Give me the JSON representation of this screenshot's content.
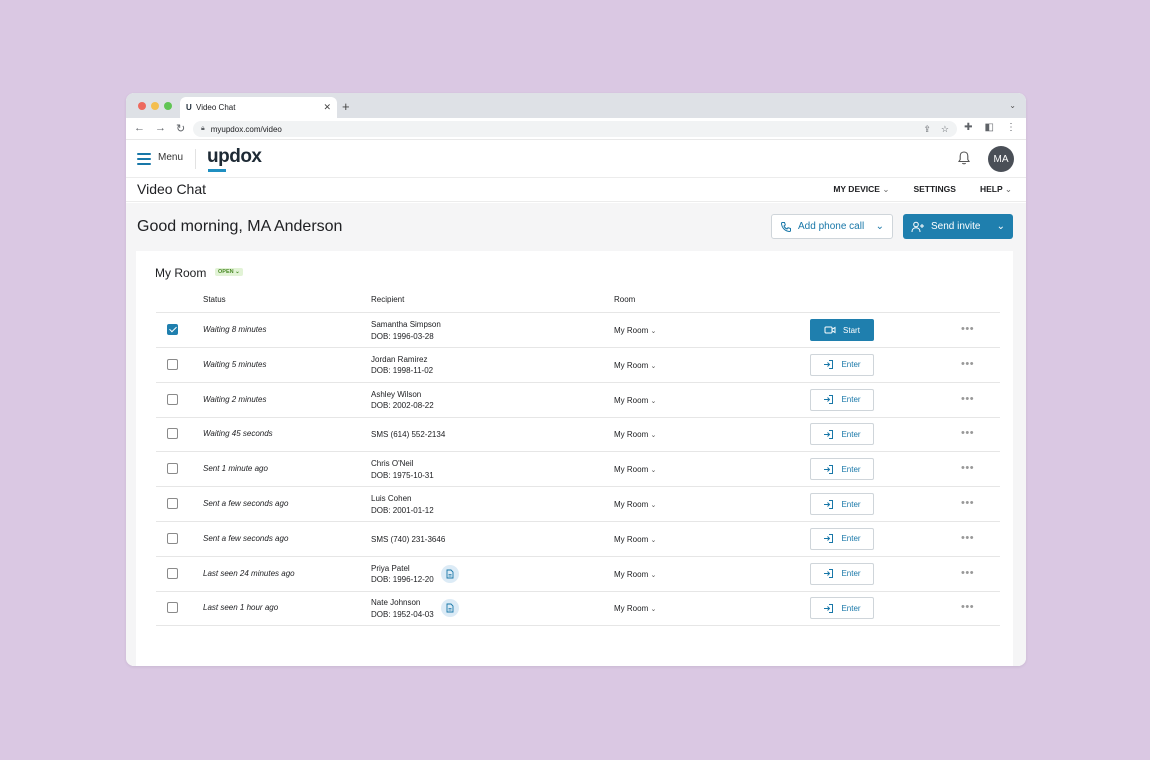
{
  "browser": {
    "tab_title": "Video Chat",
    "tab_favicon": "U",
    "url": "myupdox.com/video"
  },
  "header": {
    "menu_label": "Menu",
    "logo": "updox",
    "avatar_initials": "MA"
  },
  "subheader": {
    "title": "Video Chat",
    "nav": [
      "MY DEVICE",
      "SETTINGS",
      "HELP"
    ]
  },
  "main": {
    "greeting": "Good morning, MA Anderson",
    "add_phone_label": "Add phone call",
    "send_invite_label": "Send invite"
  },
  "room": {
    "title": "My Room",
    "badge": "OPEN",
    "columns": [
      "Status",
      "Recipient",
      "Room"
    ],
    "rows": [
      {
        "checked": true,
        "status": "Waiting 8 minutes",
        "name": "Samantha Simpson",
        "dob": "DOB: 1996-03-28",
        "room": "My Room",
        "action": "Start",
        "doc": false
      },
      {
        "checked": false,
        "status": "Waiting 5 minutes",
        "name": "Jordan Ramirez",
        "dob": "DOB: 1998-11-02",
        "room": "My Room",
        "action": "Enter",
        "doc": false
      },
      {
        "checked": false,
        "status": "Waiting 2 minutes",
        "name": "Ashley Wilson",
        "dob": "DOB: 2002-08-22",
        "room": "My Room",
        "action": "Enter",
        "doc": false
      },
      {
        "checked": false,
        "status": "Waiting 45 seconds",
        "name": "SMS (614) 552-2134",
        "dob": "",
        "room": "My Room",
        "action": "Enter",
        "doc": false
      },
      {
        "checked": false,
        "status": "Sent 1 minute ago",
        "name": "Chris O'Neil",
        "dob": "DOB: 1975-10-31",
        "room": "My Room",
        "action": "Enter",
        "doc": false
      },
      {
        "checked": false,
        "status": "Sent a few seconds ago",
        "name": "Luis Cohen",
        "dob": "DOB: 2001-01-12",
        "room": "My Room",
        "action": "Enter",
        "doc": false
      },
      {
        "checked": false,
        "status": "Sent a few seconds ago",
        "name": "SMS (740) 231-3646",
        "dob": "",
        "room": "My Room",
        "action": "Enter",
        "doc": false
      },
      {
        "checked": false,
        "status": "Last seen 24 minutes ago",
        "name": "Priya Patel",
        "dob": "DOB: 1996-12-20",
        "room": "My Room",
        "action": "Enter",
        "doc": true
      },
      {
        "checked": false,
        "status": "Last seen 1 hour ago",
        "name": "Nate Johnson",
        "dob": "DOB: 1952-04-03",
        "room": "My Room",
        "action": "Enter",
        "doc": true
      }
    ]
  },
  "colors": {
    "background": "#dac8e3",
    "accent": "#1f7fae",
    "badge_bg": "#e2f3d6",
    "badge_text": "#4a8a26"
  },
  "icons": [
    "hamburger-icon",
    "bell-icon",
    "phone-icon",
    "add-user-icon",
    "video-icon",
    "enter-icon",
    "document-icon",
    "more-icon",
    "chevron-down-icon"
  ]
}
